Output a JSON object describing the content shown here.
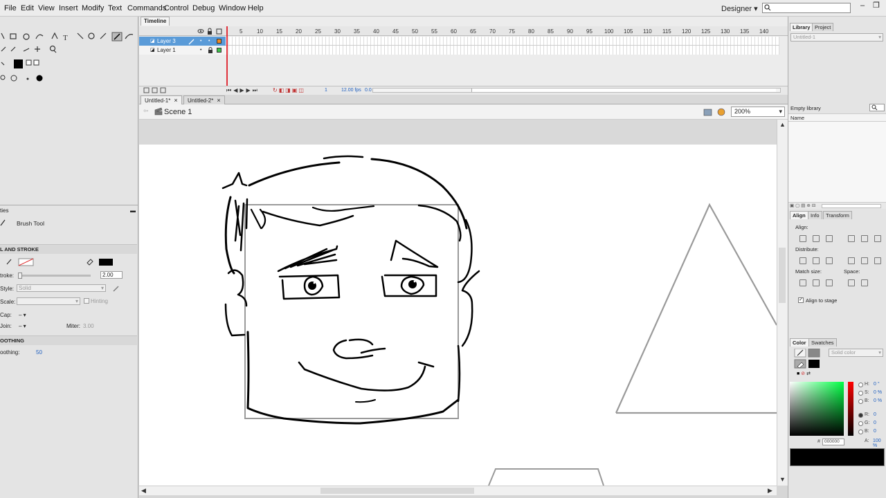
{
  "menu": [
    "File",
    "Edit",
    "View",
    "Insert",
    "Modify",
    "Text",
    "Commands",
    "Control",
    "Debug",
    "Window",
    "Help"
  ],
  "workspace": "Designer",
  "window_buttons": [
    "–",
    "❐"
  ],
  "timeline": {
    "tab": "Timeline",
    "frame_numbers": [
      "5",
      "10",
      "15",
      "20",
      "25",
      "30",
      "35",
      "40",
      "45",
      "50",
      "55",
      "60",
      "65",
      "70",
      "75",
      "80",
      "85",
      "90",
      "95",
      "100",
      "105",
      "110",
      "115",
      "120",
      "125",
      "130",
      "135",
      "140"
    ],
    "layers": [
      {
        "name": "Layer 3",
        "selected": true,
        "color": "#f08a24"
      },
      {
        "name": "Layer 1",
        "selected": false,
        "color": "#3cc24a"
      }
    ],
    "current_frame": "1",
    "fps": "12.00 fps",
    "time": "0.0 s"
  },
  "doc_tabs": [
    {
      "title": "Untitled-1*",
      "close": "×",
      "active": true
    },
    {
      "title": "Untitled-2*",
      "close": "×",
      "active": false
    }
  ],
  "scene": {
    "label": "Scene 1",
    "zoom": "200%"
  },
  "properties": {
    "tab": "ties",
    "tool_name": "Brush Tool",
    "section_fill_stroke": "L AND STROKE",
    "stroke_label": "troke:",
    "stroke_value": "2.00",
    "style_label": "Style:",
    "style_value": "Solid",
    "scale_label": "Scale:",
    "hinting_label": "Hinting",
    "cap_label": "Cap:",
    "cap_value": "– ▾",
    "join_label": "Join:",
    "join_value": "– ▾",
    "miter_label": "Miter:",
    "miter_value": "3.00",
    "section_smoothing": "OOTHING",
    "smoothing_label": "oothing:",
    "smoothing_value": "50"
  },
  "library": {
    "tabs": [
      "Library",
      "Project"
    ],
    "doc_select": "Untitled-1",
    "status": "Empty library",
    "column": "Name"
  },
  "align": {
    "tabs": [
      "Align",
      "Info",
      "Transform"
    ],
    "align_label": "Align:",
    "distribute_label": "Distribute:",
    "match_size_label": "Match size:",
    "space_label": "Space:",
    "align_to_stage": "Align to stage"
  },
  "color": {
    "tabs": [
      "Color",
      "Swatches"
    ],
    "type": "Solid color",
    "fields": [
      {
        "label": "H:",
        "value": "0 °"
      },
      {
        "label": "S:",
        "value": "0 %"
      },
      {
        "label": "B:",
        "value": "0 %"
      },
      {
        "label": "R:",
        "value": "0"
      },
      {
        "label": "G:",
        "value": "0"
      },
      {
        "label": "B:",
        "value": "0"
      }
    ],
    "hex_label": "#",
    "hex": "000000",
    "alpha_label": "A:",
    "alpha": "100 %",
    "fill": "#000000"
  },
  "icons": [
    "search-icon",
    "pen-icon",
    "lock-icon",
    "eye-icon",
    "brush-icon",
    "scene-icon",
    "zoom-icon"
  ]
}
